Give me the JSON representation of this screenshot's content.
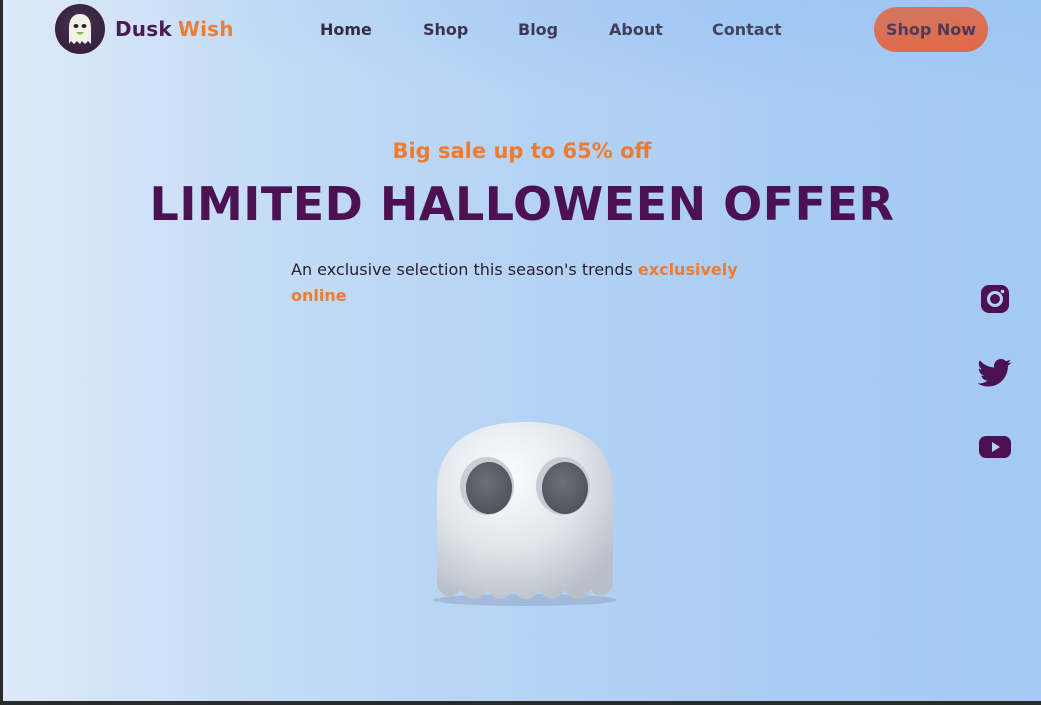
{
  "brand": {
    "part1": "Dusk",
    "part2": "Wish",
    "logo_icon": "ghost-logo-icon"
  },
  "nav": {
    "items": [
      {
        "label": "Home"
      },
      {
        "label": "Shop"
      },
      {
        "label": "Blog"
      },
      {
        "label": "About"
      },
      {
        "label": "Contact"
      }
    ],
    "cta_label": "Shop Now"
  },
  "hero": {
    "kicker": "Big sale up to 65% off",
    "headline": "LIMITED HALLOWEEN OFFER",
    "subtitle_plain": "An exclusive selection this season's trends ",
    "subtitle_highlight": "exclusively online",
    "illustration": "ghost-illustration"
  },
  "social": [
    {
      "icon": "instagram-icon"
    },
    {
      "icon": "twitter-icon"
    },
    {
      "icon": "youtube-icon"
    }
  ],
  "colors": {
    "accent_orange": "#ee7b32",
    "button_orange": "#f05b28",
    "brand_purple": "#4b1152",
    "background_blue": "#b5d3f4"
  }
}
